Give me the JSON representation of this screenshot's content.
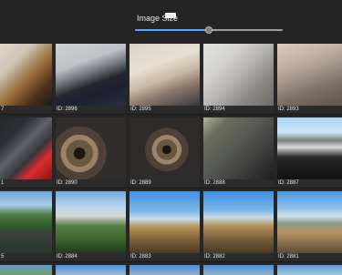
{
  "header": {
    "title": "Image Size",
    "badge_text": "",
    "slider": {
      "fraction": 0.5
    }
  },
  "gallery": {
    "rows": [
      [
        {
          "id": "7"
        },
        {
          "id": "ID: 2896"
        },
        {
          "id": "ID: 2895"
        },
        {
          "id": "ID: 2894"
        },
        {
          "id": "ID: 2893"
        }
      ],
      [
        {
          "id": "1"
        },
        {
          "id": "ID: 2890"
        },
        {
          "id": "ID: 2889"
        },
        {
          "id": "ID: 2888"
        },
        {
          "id": "ID: 2887"
        }
      ],
      [
        {
          "id": "5"
        },
        {
          "id": "ID: 2884"
        },
        {
          "id": "ID: 2883"
        },
        {
          "id": "ID: 2882"
        },
        {
          "id": "ID: 2881"
        }
      ]
    ]
  },
  "colors": {
    "background": "#262626",
    "accent": "#58a6ff",
    "text": "#e6e6e6"
  }
}
